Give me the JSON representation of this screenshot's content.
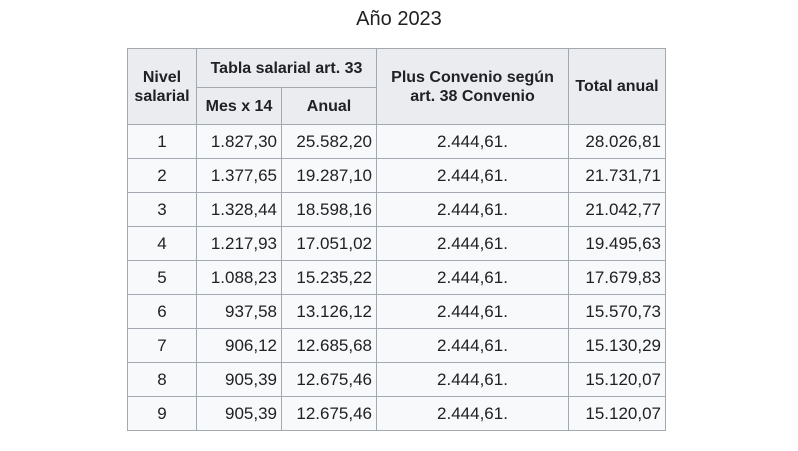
{
  "caption": "Año 2023",
  "headers": {
    "nivel": "Nivel salarial",
    "tabla": "Tabla salarial art. 33",
    "mes": "Mes x 14",
    "anual": "Anual",
    "plus": "Plus Convenio según art. 38 Convenio",
    "total": "Total anual"
  },
  "rows": [
    {
      "nivel": "1",
      "mes": "1.827,30",
      "anual": "25.582,20",
      "plus": "2.444,61.",
      "total": "28.026,81"
    },
    {
      "nivel": "2",
      "mes": "1.377,65",
      "anual": "19.287,10",
      "plus": "2.444,61.",
      "total": "21.731,71"
    },
    {
      "nivel": "3",
      "mes": "1.328,44",
      "anual": "18.598,16",
      "plus": "2.444,61.",
      "total": "21.042,77"
    },
    {
      "nivel": "4",
      "mes": "1.217,93",
      "anual": "17.051,02",
      "plus": "2.444,61.",
      "total": "19.495,63"
    },
    {
      "nivel": "5",
      "mes": "1.088,23",
      "anual": "15.235,22",
      "plus": "2.444,61.",
      "total": "17.679,83"
    },
    {
      "nivel": "6",
      "mes": "937,58",
      "anual": "13.126,12",
      "plus": "2.444,61.",
      "total": "15.570,73"
    },
    {
      "nivel": "7",
      "mes": "906,12",
      "anual": "12.685,68",
      "plus": "2.444,61.",
      "total": "15.130,29"
    },
    {
      "nivel": "8",
      "mes": "905,39",
      "anual": "12.675,46",
      "plus": "2.444,61.",
      "total": "15.120,07"
    },
    {
      "nivel": "9",
      "mes": "905,39",
      "anual": "12.675,46",
      "plus": "2.444,61.",
      "total": "15.120,07"
    }
  ]
}
